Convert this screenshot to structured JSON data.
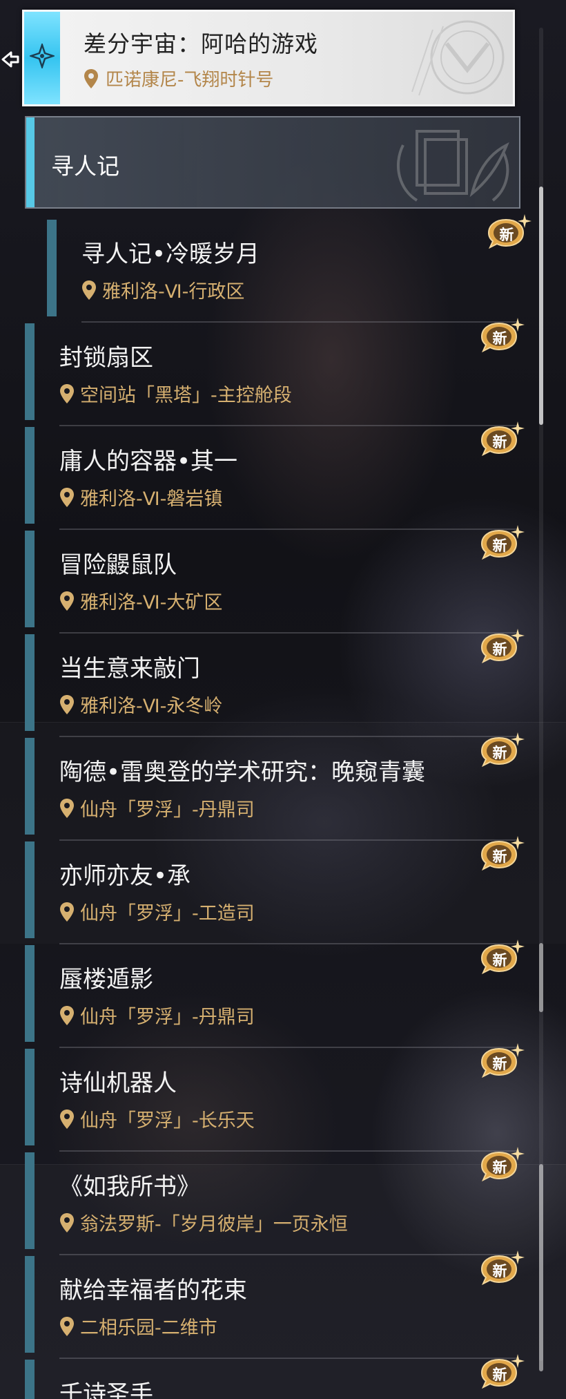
{
  "header": {
    "title": "差分宇宙：阿哈的游戏",
    "location": "匹诺康尼-飞翔时针号"
  },
  "category": {
    "label": "寻人记"
  },
  "badge_label": "新",
  "colors": {
    "accent_cyan": "#57c8e6",
    "quest_bar": "#3c7488",
    "location_gold": "#d6b070",
    "badge_gold": "#e2a84a"
  },
  "quests": [
    {
      "title": "寻人记•冷暖岁月",
      "location": "雅利洛-Ⅵ-行政区",
      "is_new": true
    },
    {
      "title": "封锁扇区",
      "location": "空间站「黑塔」-主控舱段",
      "is_new": true
    },
    {
      "title": "庸人的容器•其一",
      "location": "雅利洛-Ⅵ-磐岩镇",
      "is_new": true
    },
    {
      "title": "冒险鼹鼠队",
      "location": "雅利洛-Ⅵ-大矿区",
      "is_new": true
    },
    {
      "title": "当生意来敲门",
      "location": "雅利洛-Ⅵ-永冬岭",
      "is_new": true
    },
    {
      "title": "陶德•雷奥登的学术研究：晚窥青囊",
      "location": "仙舟「罗浮」-丹鼎司",
      "is_new": true
    },
    {
      "title": "亦师亦友•承",
      "location": "仙舟「罗浮」-工造司",
      "is_new": true
    },
    {
      "title": "蜃楼遁影",
      "location": "仙舟「罗浮」-丹鼎司",
      "is_new": true
    },
    {
      "title": "诗仙机器人",
      "location": "仙舟「罗浮」-长乐天",
      "is_new": true
    },
    {
      "title": "《如我所书》",
      "location": "翁法罗斯-「岁月彼岸」一页永恒",
      "is_new": true
    },
    {
      "title": "献给幸福者的花束",
      "location": "二相乐园-二维市",
      "is_new": true
    },
    {
      "title": "千诗圣手",
      "location": "",
      "is_new": true
    }
  ]
}
